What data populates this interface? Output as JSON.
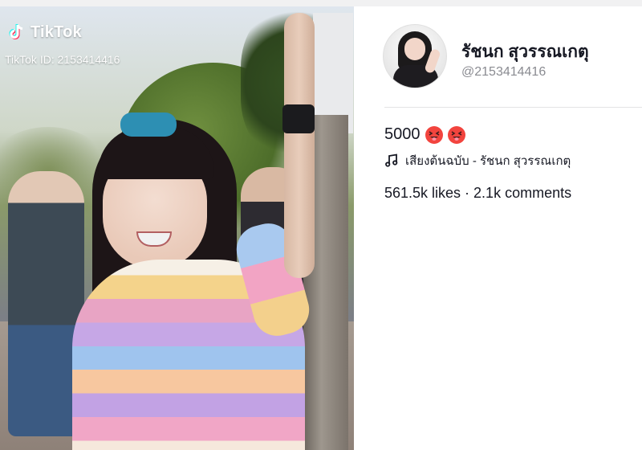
{
  "video": {
    "brand": "TikTok",
    "id_text": "TikTok ID: 2153414416"
  },
  "author": {
    "display_name": "รัชนก สุวรรณเกตุ",
    "handle": "@2153414416"
  },
  "caption": {
    "text": "5000",
    "emojis": [
      "squinting-face-with-tongue",
      "squinting-face-with-tongue"
    ]
  },
  "sound": {
    "label": "เสียงต้นฉบับ - รัชนก สุวรรณเกตุ",
    "icon": "music-note-icon"
  },
  "stats": {
    "text": "561.5k likes · 2.1k comments"
  },
  "colors": {
    "accent_red": "#f2443e",
    "text_primary": "#161823",
    "text_secondary": "#8a8b91"
  }
}
